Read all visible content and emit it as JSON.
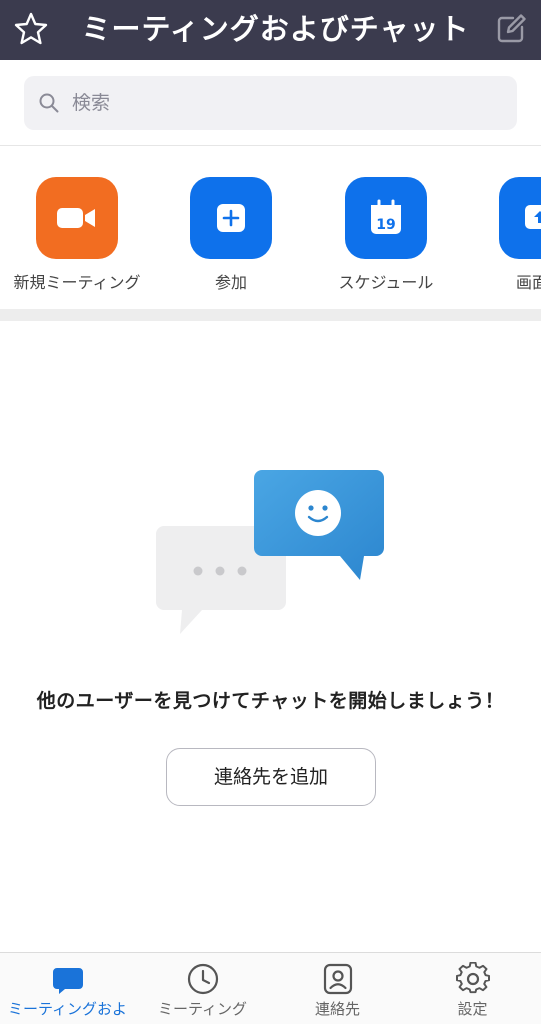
{
  "header": {
    "title": "ミーティングおよびチャット",
    "star_icon": "star-icon",
    "compose_icon": "compose-icon"
  },
  "search": {
    "placeholder": "検索",
    "icon": "search-icon"
  },
  "quick_actions": [
    {
      "label": "新規ミーティング",
      "icon": "video-camera-icon",
      "color": "#f26d21"
    },
    {
      "label": "参加",
      "icon": "plus-icon",
      "color": "#0e71eb"
    },
    {
      "label": "スケジュール",
      "icon": "calendar-icon",
      "color": "#0e71eb",
      "calendar_day": "19"
    },
    {
      "label": "画面の",
      "icon": "share-screen-icon",
      "color": "#0e71eb"
    }
  ],
  "empty_state": {
    "message": "他のユーザーを見つけてチャットを開始しましょう！",
    "button_label": "連絡先を追加"
  },
  "bottom_nav": [
    {
      "label": "ミーティングおよ",
      "icon": "chat-bubble-icon",
      "active": true
    },
    {
      "label": "ミーティング",
      "icon": "clock-icon",
      "active": false
    },
    {
      "label": "連絡先",
      "icon": "contact-icon",
      "active": false
    },
    {
      "label": "設定",
      "icon": "gear-icon",
      "active": false
    }
  ],
  "colors": {
    "header_bg": "#3b3b4e",
    "accent_blue": "#0e71eb",
    "accent_orange": "#f26d21",
    "active_nav": "#1a73d9"
  }
}
